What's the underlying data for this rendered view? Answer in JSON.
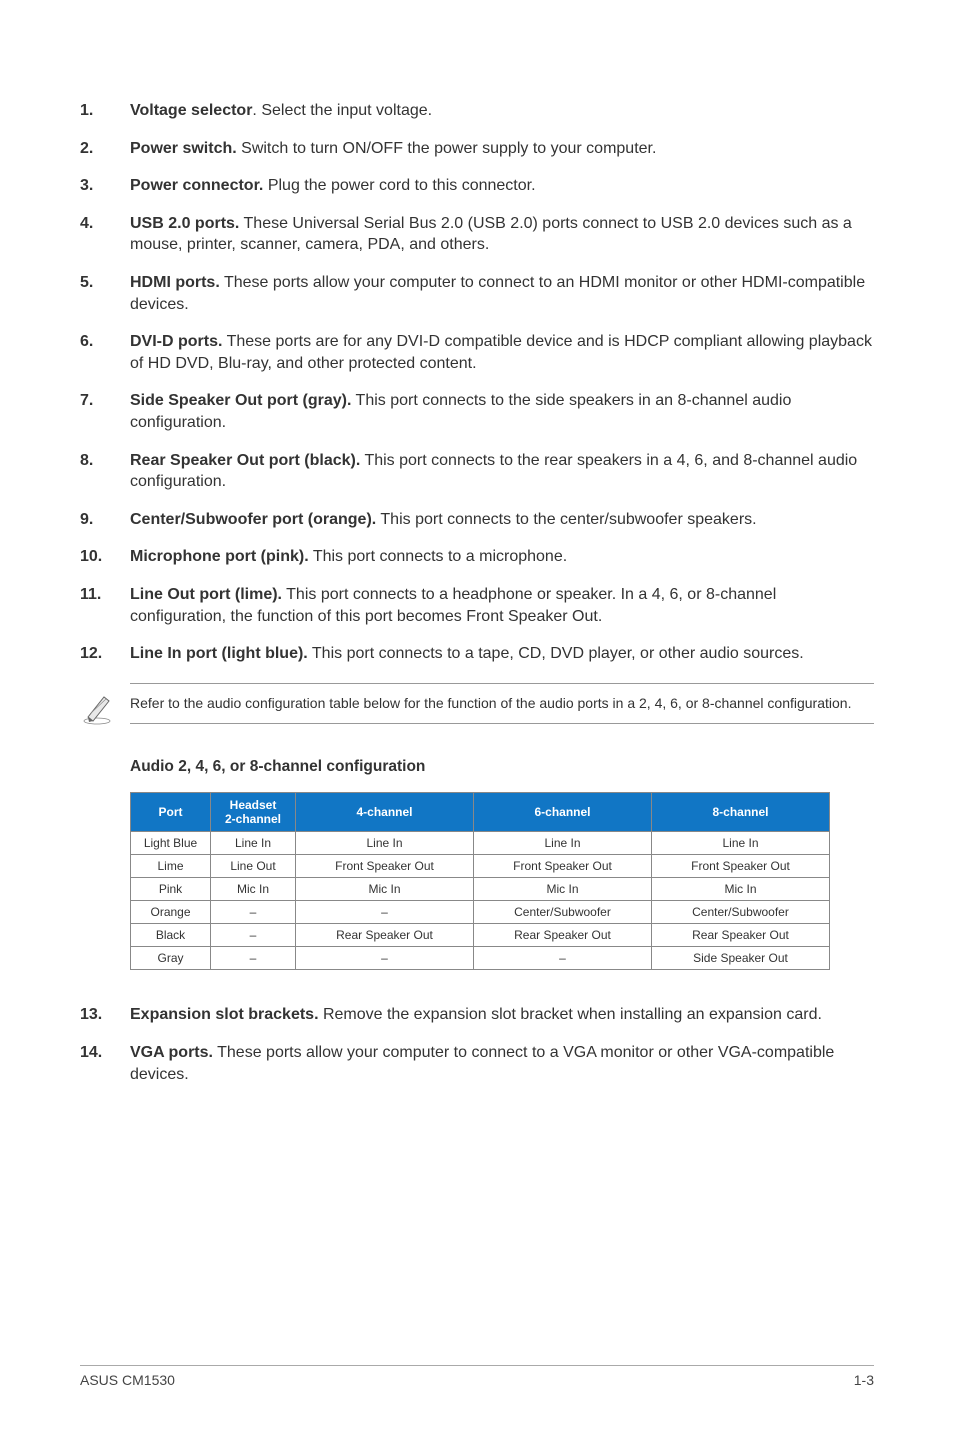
{
  "items": [
    {
      "num": "1.",
      "title": "Voltage selector",
      "sep": ". ",
      "desc": "Select the input voltage."
    },
    {
      "num": "2.",
      "title": "Power switch.",
      "sep": " ",
      "desc": "Switch to turn ON/OFF the power supply to your computer."
    },
    {
      "num": "3.",
      "title": "Power connector.",
      "sep": " ",
      "desc": "Plug the power cord to this connector."
    },
    {
      "num": "4.",
      "title": "USB 2.0 ports.",
      "sep": " ",
      "desc": "These Universal Serial Bus 2.0 (USB 2.0) ports connect to USB 2.0 devices such as a mouse, printer, scanner, camera, PDA, and others."
    },
    {
      "num": "5.",
      "title": "HDMI ports.",
      "sep": " ",
      "desc": "These ports allow your computer to connect to an HDMI monitor or other HDMI-compatible devices."
    },
    {
      "num": "6.",
      "title": "DVI-D ports.",
      "sep": " ",
      "desc": "These ports are for any DVI-D compatible device and is HDCP compliant allowing playback of HD DVD, Blu-ray, and other protected content."
    },
    {
      "num": "7.",
      "title": "Side Speaker Out port (gray).",
      "sep": " ",
      "desc": "This port connects to the side speakers in an 8-channel audio configuration."
    },
    {
      "num": "8.",
      "title": "Rear Speaker Out port (black).",
      "sep": " ",
      "desc": "This port connects to the rear speakers in a 4, 6, and 8-channel audio configuration."
    },
    {
      "num": "9.",
      "title": "Center/Subwoofer port (orange).",
      "sep": " ",
      "desc": "This port connects to the center/subwoofer speakers."
    },
    {
      "num": "10.",
      "title": "Microphone port (pink).",
      "sep": " ",
      "desc": "This port connects to a microphone."
    },
    {
      "num": "11.",
      "title": "Line Out port (lime).",
      "sep": " ",
      "desc": "This port connects to a headphone or speaker. In a 4, 6, or 8-channel configuration, the function of this port becomes Front Speaker Out."
    },
    {
      "num": "12.",
      "title": "Line In port (light blue).",
      "sep": " ",
      "desc": "This port connects to a tape, CD, DVD player, or other audio sources."
    }
  ],
  "note": "Refer to the audio configuration table below for the function of the audio ports in a 2, 4, 6, or 8-channel configuration.",
  "audio_heading": "Audio 2, 4, 6, or 8-channel configuration",
  "table": {
    "headers": {
      "port": "Port",
      "h2": "Headset\n2-channel",
      "h4": "4-channel",
      "h6": "6-channel",
      "h8": "8-channel"
    },
    "rows": [
      {
        "port": "Light Blue",
        "c2": "Line In",
        "c4": "Line In",
        "c6": "Line In",
        "c8": "Line In"
      },
      {
        "port": "Lime",
        "c2": "Line Out",
        "c4": "Front Speaker Out",
        "c6": "Front Speaker Out",
        "c8": "Front Speaker Out"
      },
      {
        "port": "Pink",
        "c2": "Mic In",
        "c4": "Mic In",
        "c6": "Mic In",
        "c8": "Mic In"
      },
      {
        "port": "Orange",
        "c2": "–",
        "c4": "–",
        "c6": "Center/Subwoofer",
        "c8": "Center/Subwoofer"
      },
      {
        "port": "Black",
        "c2": "–",
        "c4": "Rear Speaker Out",
        "c6": "Rear Speaker Out",
        "c8": "Rear Speaker Out"
      },
      {
        "port": "Gray",
        "c2": "–",
        "c4": "–",
        "c6": "–",
        "c8": "Side Speaker Out"
      }
    ]
  },
  "items2": [
    {
      "num": "13.",
      "title": "Expansion slot brackets.",
      "sep": " ",
      "desc": "Remove the expansion slot bracket when installing an expansion card."
    },
    {
      "num": "14.",
      "title": "VGA ports.",
      "sep": " ",
      "desc": "These ports allow your computer to connect to a VGA monitor or other VGA-compatible devices."
    }
  ],
  "footer": {
    "left": "ASUS CM1530",
    "right": "1-3"
  }
}
